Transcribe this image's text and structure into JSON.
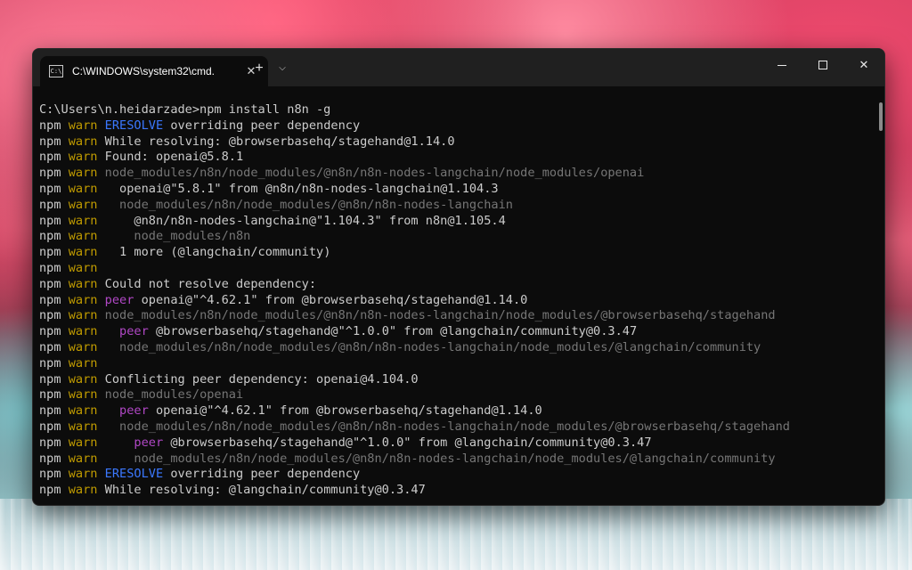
{
  "window": {
    "tab_title": "C:\\WINDOWS\\system32\\cmd.",
    "tab_icon_text": "C:\\",
    "icons": {
      "tab_close": "close-icon",
      "new_tab": "plus-icon",
      "dropdown": "chevron-down-icon",
      "minimize": "minimize-icon",
      "maximize": "maximize-icon",
      "close": "close-icon"
    }
  },
  "terminal": {
    "lines": [
      [
        {
          "t": "C:\\Users\\n.heidarzade>npm install n8n -g",
          "c": "white"
        }
      ],
      [
        {
          "t": "npm ",
          "c": "npm"
        },
        {
          "t": "warn ",
          "c": "warn"
        },
        {
          "t": "ERESOLVE",
          "c": "blue"
        },
        {
          "t": " overriding peer dependency",
          "c": "white"
        }
      ],
      [
        {
          "t": "npm ",
          "c": "npm"
        },
        {
          "t": "warn ",
          "c": "warn"
        },
        {
          "t": "While resolving: @browserbasehq/stagehand@1.14.0",
          "c": "white"
        }
      ],
      [
        {
          "t": "npm ",
          "c": "npm"
        },
        {
          "t": "warn ",
          "c": "warn"
        },
        {
          "t": "Found: openai@5.8.1",
          "c": "white"
        }
      ],
      [
        {
          "t": "npm ",
          "c": "npm"
        },
        {
          "t": "warn ",
          "c": "warn"
        },
        {
          "t": "node_modules/n8n/node_modules/@n8n/n8n-nodes-langchain/node_modules/openai",
          "c": "dim"
        }
      ],
      [
        {
          "t": "npm ",
          "c": "npm"
        },
        {
          "t": "warn ",
          "c": "warn"
        },
        {
          "t": "  openai@\"5.8.1\" from @n8n/n8n-nodes-langchain@1.104.3",
          "c": "white"
        }
      ],
      [
        {
          "t": "npm ",
          "c": "npm"
        },
        {
          "t": "warn ",
          "c": "warn"
        },
        {
          "t": "  node_modules/n8n/node_modules/@n8n/n8n-nodes-langchain",
          "c": "dim"
        }
      ],
      [
        {
          "t": "npm ",
          "c": "npm"
        },
        {
          "t": "warn ",
          "c": "warn"
        },
        {
          "t": "    @n8n/n8n-nodes-langchain@\"1.104.3\" from n8n@1.105.4",
          "c": "white"
        }
      ],
      [
        {
          "t": "npm ",
          "c": "npm"
        },
        {
          "t": "warn ",
          "c": "warn"
        },
        {
          "t": "    node_modules/n8n",
          "c": "dim"
        }
      ],
      [
        {
          "t": "npm ",
          "c": "npm"
        },
        {
          "t": "warn ",
          "c": "warn"
        },
        {
          "t": "  1 more (@langchain/community)",
          "c": "white"
        }
      ],
      [
        {
          "t": "npm ",
          "c": "npm"
        },
        {
          "t": "warn",
          "c": "warn"
        }
      ],
      [
        {
          "t": "npm ",
          "c": "npm"
        },
        {
          "t": "warn ",
          "c": "warn"
        },
        {
          "t": "Could not resolve dependency:",
          "c": "white"
        }
      ],
      [
        {
          "t": "npm ",
          "c": "npm"
        },
        {
          "t": "warn ",
          "c": "warn"
        },
        {
          "t": "peer",
          "c": "magenta"
        },
        {
          "t": " openai@\"^4.62.1\" from @browserbasehq/stagehand@1.14.0",
          "c": "white"
        }
      ],
      [
        {
          "t": "npm ",
          "c": "npm"
        },
        {
          "t": "warn ",
          "c": "warn"
        },
        {
          "t": "node_modules/n8n/node_modules/@n8n/n8n-nodes-langchain/node_modules/@browserbasehq/stagehand",
          "c": "dim"
        }
      ],
      [
        {
          "t": "npm ",
          "c": "npm"
        },
        {
          "t": "warn ",
          "c": "warn"
        },
        {
          "t": "  ",
          "c": "white"
        },
        {
          "t": "peer",
          "c": "magenta"
        },
        {
          "t": " @browserbasehq/stagehand@\"^1.0.0\" from @langchain/community@0.3.47",
          "c": "white"
        }
      ],
      [
        {
          "t": "npm ",
          "c": "npm"
        },
        {
          "t": "warn ",
          "c": "warn"
        },
        {
          "t": "  node_modules/n8n/node_modules/@n8n/n8n-nodes-langchain/node_modules/@langchain/community",
          "c": "dim"
        }
      ],
      [
        {
          "t": "npm ",
          "c": "npm"
        },
        {
          "t": "warn",
          "c": "warn"
        }
      ],
      [
        {
          "t": "npm ",
          "c": "npm"
        },
        {
          "t": "warn ",
          "c": "warn"
        },
        {
          "t": "Conflicting peer dependency: openai@4.104.0",
          "c": "white"
        }
      ],
      [
        {
          "t": "npm ",
          "c": "npm"
        },
        {
          "t": "warn ",
          "c": "warn"
        },
        {
          "t": "node_modules/openai",
          "c": "dim"
        }
      ],
      [
        {
          "t": "npm ",
          "c": "npm"
        },
        {
          "t": "warn ",
          "c": "warn"
        },
        {
          "t": "  ",
          "c": "white"
        },
        {
          "t": "peer",
          "c": "magenta"
        },
        {
          "t": " openai@\"^4.62.1\" from @browserbasehq/stagehand@1.14.0",
          "c": "white"
        }
      ],
      [
        {
          "t": "npm ",
          "c": "npm"
        },
        {
          "t": "warn ",
          "c": "warn"
        },
        {
          "t": "  node_modules/n8n/node_modules/@n8n/n8n-nodes-langchain/node_modules/@browserbasehq/stagehand",
          "c": "dim"
        }
      ],
      [
        {
          "t": "npm ",
          "c": "npm"
        },
        {
          "t": "warn ",
          "c": "warn"
        },
        {
          "t": "    ",
          "c": "white"
        },
        {
          "t": "peer",
          "c": "magenta"
        },
        {
          "t": " @browserbasehq/stagehand@\"^1.0.0\" from @langchain/community@0.3.47",
          "c": "white"
        }
      ],
      [
        {
          "t": "npm ",
          "c": "npm"
        },
        {
          "t": "warn ",
          "c": "warn"
        },
        {
          "t": "    node_modules/n8n/node_modules/@n8n/n8n-nodes-langchain/node_modules/@langchain/community",
          "c": "dim"
        }
      ],
      [
        {
          "t": "npm ",
          "c": "npm"
        },
        {
          "t": "warn ",
          "c": "warn"
        },
        {
          "t": "ERESOLVE",
          "c": "blue"
        },
        {
          "t": " overriding peer dependency",
          "c": "white"
        }
      ],
      [
        {
          "t": "npm ",
          "c": "npm"
        },
        {
          "t": "warn ",
          "c": "warn"
        },
        {
          "t": "While resolving: @langchain/community@0.3.47",
          "c": "white"
        }
      ]
    ]
  },
  "colors": {
    "terminal_bg": "#0c0c0c",
    "titlebar_bg": "#202020",
    "warn": "#c19c00",
    "blue": "#3b78ff",
    "magenta": "#b148c6",
    "dim": "#767676",
    "text": "#cccccc"
  }
}
